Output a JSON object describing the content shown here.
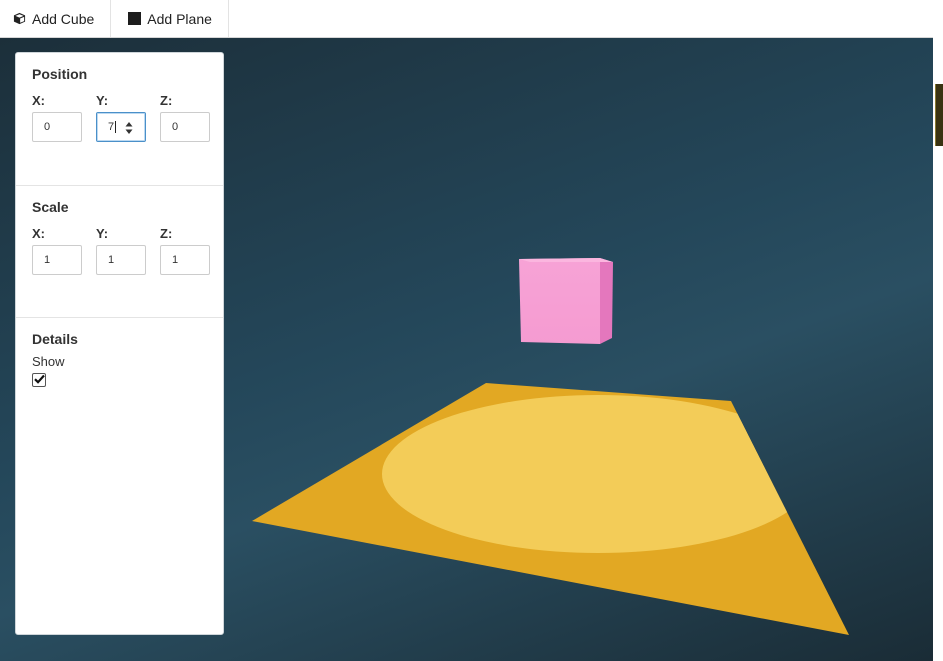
{
  "toolbar": {
    "add_cube_label": "Add Cube",
    "add_plane_label": "Add Plane"
  },
  "panel": {
    "position": {
      "title": "Position",
      "x_label": "X:",
      "y_label": "Y:",
      "z_label": "Z:",
      "x_value": "0",
      "y_value": "7",
      "z_value": "0"
    },
    "scale": {
      "title": "Scale",
      "x_label": "X:",
      "y_label": "Y:",
      "z_label": "Z:",
      "x_value": "1",
      "y_value": "1",
      "z_value": "1"
    },
    "details": {
      "title": "Details",
      "show_label": "Show",
      "show_checked": true
    }
  },
  "scene": {
    "cube_color": "#f59fd3",
    "plane_color": "#e2a823",
    "light_color": "#f3cc58",
    "background_color": "#24475a"
  },
  "icons": {
    "cube": "cube-icon",
    "plane": "square-icon",
    "checkmark": "check-icon",
    "spinner": "spinner-arrows-icon"
  }
}
